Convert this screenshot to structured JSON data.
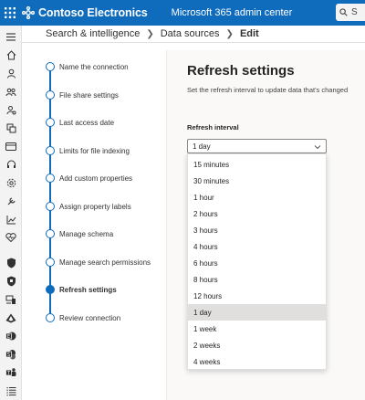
{
  "topbar": {
    "brand": "Contoso Electronics",
    "app_title": "Microsoft 365 admin center",
    "search_placeholder": "S",
    "colors": {
      "bar": "#0f6cbd"
    }
  },
  "rail_icons": [
    "menu-icon",
    "home-icon",
    "user-icon",
    "group-icon",
    "roles-icon",
    "resources-icon",
    "billing-icon",
    "support-icon",
    "settings-icon",
    "setup-icon",
    "reports-icon",
    "health-icon",
    "security-icon",
    "compliance-icon",
    "endpoint-icon",
    "azure-ad-icon",
    "exchange-icon",
    "sharepoint-icon",
    "teams-icon",
    "all-admin-centers-icon"
  ],
  "breadcrumb": {
    "items": [
      "Search & intelligence",
      "Data sources",
      "Edit"
    ]
  },
  "steps": [
    {
      "label": "Name the connection",
      "active": false
    },
    {
      "label": "File share settings",
      "active": false
    },
    {
      "label": "Last access date",
      "active": false
    },
    {
      "label": "Limits for file indexing",
      "active": false
    },
    {
      "label": "Add custom properties",
      "active": false
    },
    {
      "label": "Assign property labels",
      "active": false
    },
    {
      "label": "Manage schema",
      "active": false
    },
    {
      "label": "Manage search permissions",
      "active": false
    },
    {
      "label": "Refresh settings",
      "active": true
    },
    {
      "label": "Review connection",
      "active": false
    }
  ],
  "main": {
    "title": "Refresh settings",
    "subtitle": "Set the refresh interval to update data that's changed",
    "field_label": "Refresh interval",
    "selected_value": "1 day",
    "options": [
      "15 minutes",
      "30 minutes",
      "1 hour",
      "2 hours",
      "3 hours",
      "4 hours",
      "6 hours",
      "8 hours",
      "12 hours",
      "1 day",
      "1 week",
      "2 weeks",
      "4 weeks"
    ],
    "highlighted_option": "1 day"
  }
}
